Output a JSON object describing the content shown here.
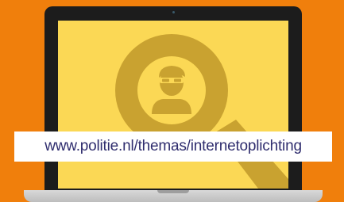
{
  "banner": {
    "url": "www.politie.nl/themas/internetoplichting"
  },
  "colors": {
    "background": "#f07f0c",
    "screen": "#fbd855",
    "magnifier": "#c9a230",
    "url_text": "#2f2d6e"
  },
  "icons": {
    "magnifier": "magnifying-glass-icon",
    "person": "masked-thief-icon"
  }
}
